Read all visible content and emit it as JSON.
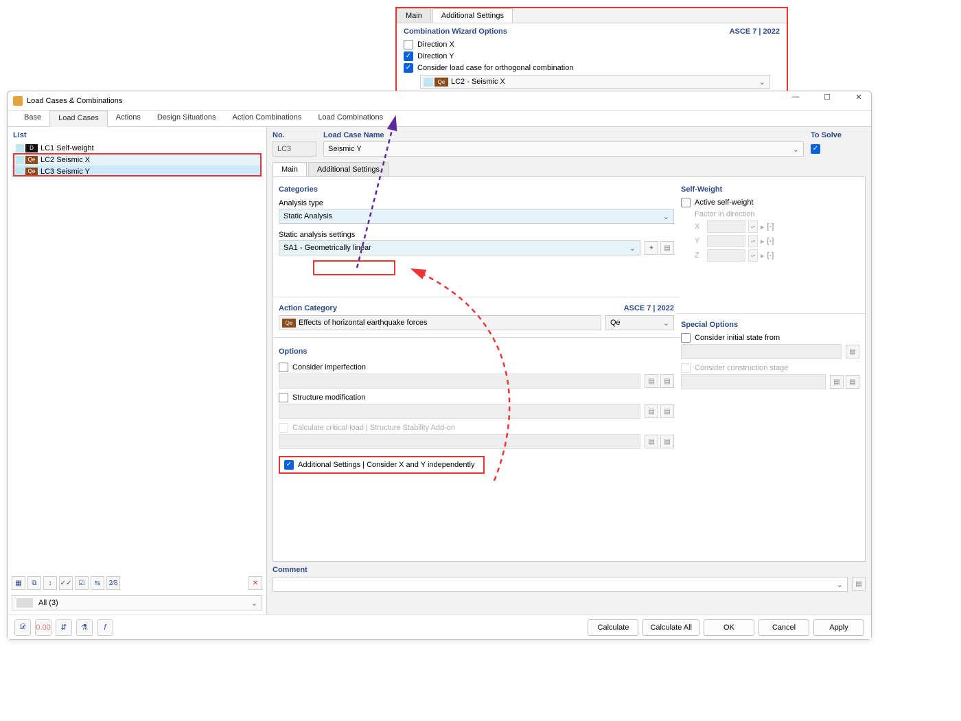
{
  "window_title": "Load Cases & Combinations",
  "popup": {
    "tab_main": "Main",
    "tab_add": "Additional Settings",
    "head": "Combination Wizard Options",
    "standard": "ASCE 7 | 2022",
    "chk_dirx": "Direction X",
    "chk_diry": "Direction Y",
    "chk_ortho": "Consider load case for orthogonal combination",
    "ortho_badge": "Qe",
    "ortho_sel": "LC2 - Seismic X"
  },
  "tabs": [
    "Base",
    "Load Cases",
    "Actions",
    "Design Situations",
    "Action Combinations",
    "Load Combinations"
  ],
  "active_tab_index": 1,
  "list": {
    "title": "List",
    "items": [
      {
        "badge": "D",
        "badge_bg": "#111",
        "label": "LC1  Self-weight"
      },
      {
        "badge": "Qe",
        "badge_bg": "#8a4a1a",
        "label": "LC2  Seismic X"
      },
      {
        "badge": "Qe",
        "badge_bg": "#8a4a1a",
        "label": "LC3  Seismic Y"
      }
    ],
    "filter": "All (3)"
  },
  "form": {
    "no_label": "No.",
    "no_value": "LC3",
    "name_label": "Load Case Name",
    "name_value": "Seismic Y",
    "solve_label": "To Solve"
  },
  "sub_tabs": {
    "main": "Main",
    "add": "Additional Settings"
  },
  "categories_title": "Categories",
  "analysis_type_label": "Analysis type",
  "analysis_type_value": "Static Analysis",
  "static_settings_label": "Static analysis settings",
  "static_settings_value": "SA1 - Geometrically linear",
  "ac_head": "Action Category",
  "ac_standard": "ASCE 7 | 2022",
  "ac_badge": "Qe",
  "ac_text": "Effects of horizontal earthquake forces",
  "ac_code": "Qe",
  "options_title": "Options",
  "opt_imperfection": "Consider imperfection",
  "opt_structmod": "Structure modification",
  "opt_critical": "Calculate critical load | Structure Stability Add-on",
  "opt_addset": "Additional Settings | Consider X and Y independently",
  "sw_title": "Self-Weight",
  "sw_active": "Active self-weight",
  "sw_factor": "Factor in direction",
  "sw_x": "X",
  "sw_y": "Y",
  "sw_z": "Z",
  "sw_unit": "[-]",
  "so_title": "Special Options",
  "so_initial": "Consider initial state from",
  "so_stage": "Consider construction stage",
  "comment_title": "Comment",
  "buttons": {
    "calculate": "Calculate",
    "calculate_all": "Calculate All",
    "ok": "OK",
    "cancel": "Cancel",
    "apply": "Apply"
  }
}
